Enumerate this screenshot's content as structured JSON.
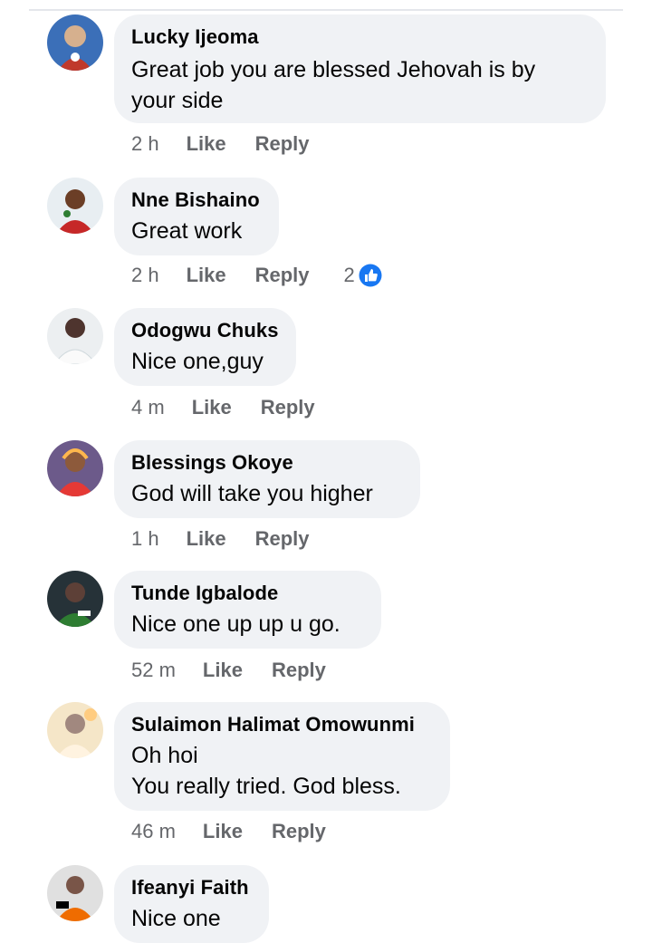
{
  "comments": [
    {
      "author": "Lucky Ijeoma",
      "text": "Great job  you are blessed Jehovah is by\nyour side",
      "time": "2 h",
      "like": "Like",
      "reply": "Reply",
      "reactions": ""
    },
    {
      "author": "Nne Bishaino",
      "text": "Great work",
      "time": "2 h",
      "like": "Like",
      "reply": "Reply",
      "reactions": "2"
    },
    {
      "author": "Odogwu Chuks",
      "text": "Nice one,guy",
      "time": "4 m",
      "like": "Like",
      "reply": "Reply",
      "reactions": ""
    },
    {
      "author": "Blessings Okoye",
      "text": "God will take you higher",
      "time": "1 h",
      "like": "Like",
      "reply": "Reply",
      "reactions": ""
    },
    {
      "author": "Tunde Igbalode",
      "text": "Nice one up up u go.",
      "time": "52 m",
      "like": "Like",
      "reply": "Reply",
      "reactions": ""
    },
    {
      "author": "Sulaimon Halimat Omowunmi",
      "text": "Oh hoi\nYou really tried. God bless.",
      "time": "46 m",
      "like": "Like",
      "reply": "Reply",
      "reactions": ""
    },
    {
      "author": "Ifeanyi Faith",
      "text": "Nice one",
      "time": "",
      "like": "",
      "reply": "",
      "reactions": ""
    }
  ],
  "colors": {
    "bubble": "#f0f2f5",
    "like_badge": "#1877f2",
    "meta": "#65676b"
  },
  "icons": {
    "reaction": "thumbs-up-icon"
  }
}
